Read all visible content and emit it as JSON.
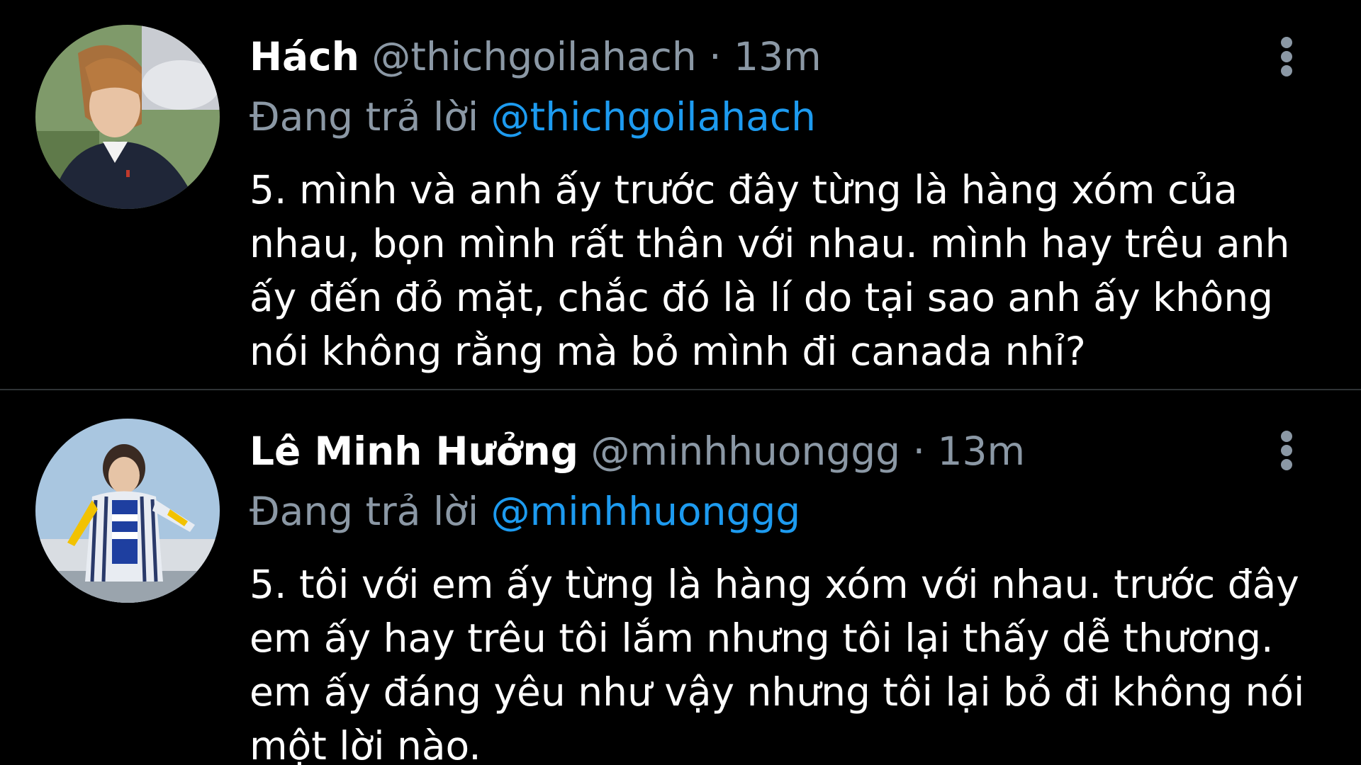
{
  "tweets": [
    {
      "display_name": "Hách",
      "handle": "@thichgoilahach",
      "separator": "·",
      "time": "13m",
      "replying_prefix": "Đang trả lời",
      "replying_to": "@thichgoilahach",
      "text_lines": [
        "5. mình và anh ấy trước đây từng là hàng xóm của",
        "nhau, bọn mình rất thân với nhau. mình hay trêu anh",
        "ấy đến đỏ mặt, chắc đó là lí do tại sao anh ấy không",
        "nói không rằng mà bỏ mình đi canada nhỉ?"
      ]
    },
    {
      "display_name": "Lê Minh Hưởng",
      "handle": "@minhhuonggg",
      "separator": "·",
      "time": "13m",
      "replying_prefix": "Đang trả lời",
      "replying_to": "@minhhuonggg",
      "text_lines": [
        "5. tôi với em ấy từng là hàng xóm với nhau. trước đây",
        "em ấy hay trêu tôi lắm nhưng tôi lại thấy dễ thương.",
        "em ấy đáng yêu như vậy nhưng tôi lại bỏ đi không nói",
        "một lời nào."
      ]
    }
  ],
  "icons": {
    "more": "more-vertical-icon"
  },
  "colors": {
    "background": "#000000",
    "primary_text": "#ffffff",
    "secondary_text": "#8b98a5",
    "mention": "#1d9bf0",
    "divider": "#2f3336"
  }
}
